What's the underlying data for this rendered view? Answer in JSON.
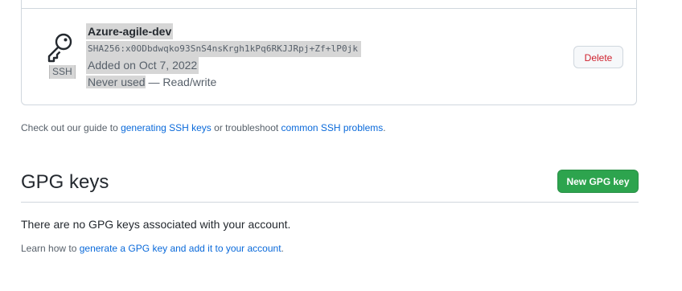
{
  "ssh_key": {
    "icon": "key-icon",
    "type_label": "SSH",
    "title": "Azure-agile-dev",
    "fingerprint": "SHA256:x0ODbdwqko93SnS4nsKrgh1kPq6RKJJRpj+Zf+lP0jk",
    "added": "Added on Oct 7, 2022",
    "used_prefix": "Never used",
    "used_suffix": " — Read/write",
    "delete_label": "Delete"
  },
  "ssh_help": {
    "prefix": "Check out our guide to ",
    "link1": "generating SSH keys",
    "middle": " or troubleshoot ",
    "link2": "common SSH problems",
    "suffix": "."
  },
  "gpg": {
    "heading": "GPG keys",
    "new_button": "New GPG key",
    "empty_message": "There are no GPG keys associated with your account.",
    "learn_prefix": "Learn how to ",
    "learn_link": "generate a GPG key and add it to your account",
    "learn_suffix": "."
  },
  "colors": {
    "link": "#0969da",
    "danger": "#cf222e",
    "primary_button": "#2da44e",
    "border": "#d0d7de",
    "selection_highlight": "#d6d6d6"
  }
}
